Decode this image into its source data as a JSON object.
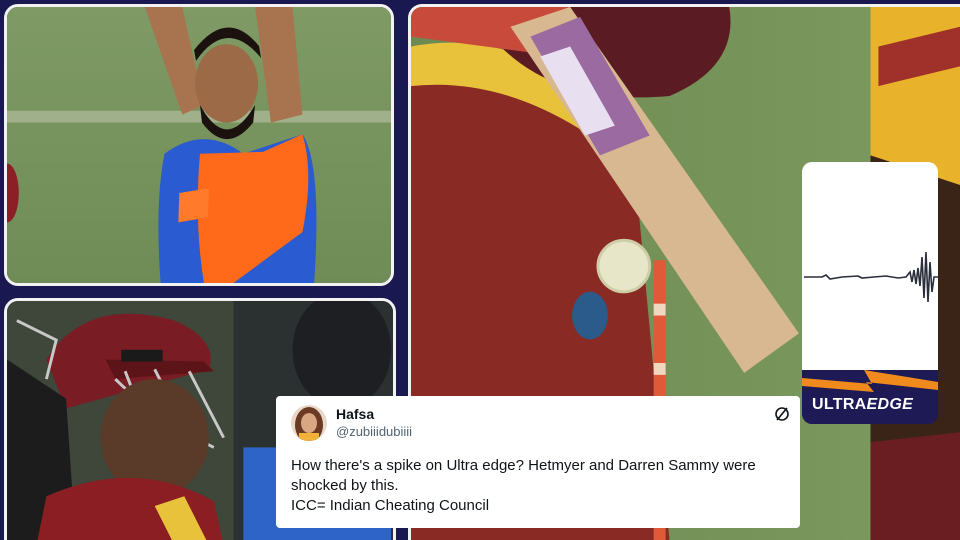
{
  "ultraedge": {
    "label_prefix": "ULTRA",
    "label_suffix": "EDGE",
    "accent_color": "#f08a1c"
  },
  "tweet": {
    "author_name": "Hafsa",
    "author_handle": "@zubiiidubiiii",
    "lines": [
      "How there's a spike on Ultra edge? Hetmyer and Darren Sammy were",
      "shocked by this.",
      "ICC= Indian Cheating Council"
    ],
    "platform_icon": "x-logo-icon"
  },
  "photos": {
    "top_left": "bowler-appealing-photo",
    "bottom_left": "batter-in-helmet-photo",
    "right": "bat-ball-closeup-photo"
  },
  "colors": {
    "frame_bg": "#1a1850",
    "panel_border": "#f2f2f2",
    "india_blue": "#2a5bd0",
    "india_orange": "#ff6a1a",
    "wi_maroon": "#8a1e22"
  }
}
